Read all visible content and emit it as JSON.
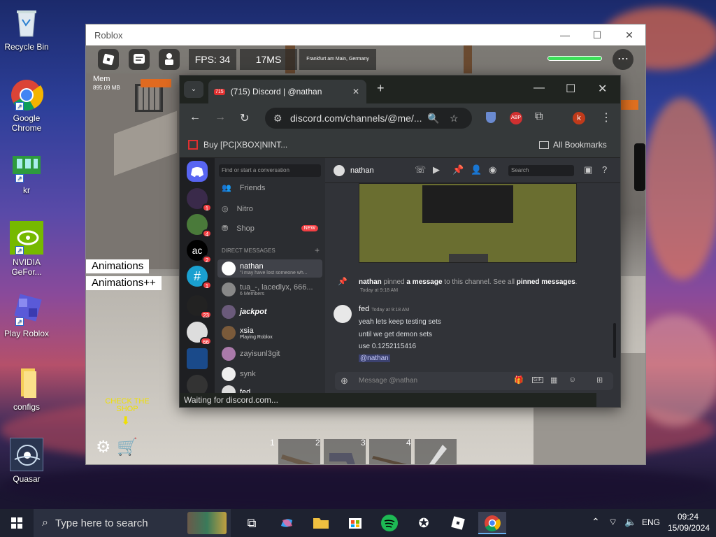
{
  "desktop": {
    "icons": [
      {
        "label": "Recycle Bin"
      },
      {
        "label": "Google Chrome"
      },
      {
        "label": "kr"
      },
      {
        "label": "NVIDIA GeFor..."
      },
      {
        "label": "Play Roblox"
      },
      {
        "label": "configs"
      },
      {
        "label": "Quasar"
      }
    ]
  },
  "roblox": {
    "title": "Roblox",
    "fps": "FPS: 34",
    "ping": "17MS",
    "server": "Frankfurt am Main, Germany",
    "mem_label": "Mem",
    "mem_value": "895.09 MB",
    "animations": "Animations",
    "animations_plus": "Animations++",
    "shop_hint": "CHECK THE SHOP",
    "hotbar": [
      "1",
      "2",
      "3",
      "4"
    ]
  },
  "chrome": {
    "tab_badge": "715",
    "tab_title": "(715) Discord | @nathan",
    "url": "discord.com/channels/@me/...",
    "profile": "k",
    "bookmark": "Buy [PC|XBOX|NINT...",
    "all_bookmarks": "All Bookmarks",
    "status": "Waiting for discord.com..."
  },
  "discord": {
    "search_conv": "Find or start a conversation",
    "nav": {
      "friends": "Friends",
      "nitro": "Nitro",
      "shop": "Shop",
      "new": "NEW"
    },
    "dm_header": "DIRECT MESSAGES",
    "servers": [
      {
        "badge": "1"
      },
      {
        "badge": "4"
      },
      {
        "badge": "2"
      },
      {
        "badge": "1"
      },
      {
        "badge": "23"
      },
      {
        "badge": "66"
      }
    ],
    "dms": [
      {
        "name": "nathan",
        "sub": "\"i may have lost someone wh..."
      },
      {
        "name": "tua_-, lacedlyx, 666...",
        "sub": "6 Members"
      },
      {
        "name": "jackpot",
        "sub": ""
      },
      {
        "name": "xsia",
        "sub": "Playing Roblox"
      },
      {
        "name": "zayisunl3git",
        "sub": ""
      },
      {
        "name": "synk",
        "sub": ""
      },
      {
        "name": "fed",
        "sub": ""
      }
    ],
    "chat_user": "nathan",
    "search": "Search",
    "pin": {
      "user": "nathan",
      "mid1": " pinned ",
      "bold1": "a message",
      "mid2": " to this channel. See all ",
      "bold2": "pinned messages",
      "end": ".",
      "time": "Today at 9:18 AM"
    },
    "message": {
      "author": "fed",
      "time": "Today at 9:18 AM",
      "lines": [
        "yeah lets keep testing sets",
        "until we get demon sets",
        "use 0.1252115416"
      ],
      "mention": "@nathan"
    },
    "input_placeholder": "Message @nathan"
  },
  "taskbar": {
    "search": "Type here to search",
    "lang": "ENG",
    "time": "09:24",
    "date": "15/09/2024"
  }
}
